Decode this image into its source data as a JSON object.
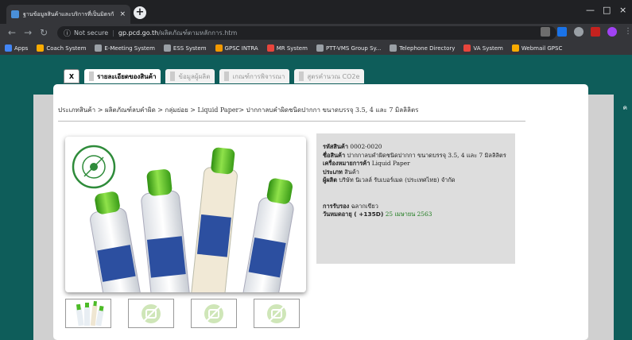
{
  "browser": {
    "tab_title": "ฐานข้อมูลสินค้าและบริการที่เป็นมิตรกั",
    "tab_close": "×",
    "new_tab": "+",
    "window_minimize": "—",
    "window_maximize": "□",
    "window_close": "×",
    "address": {
      "info": "ⓘ",
      "security_text": "Not secure",
      "domain": "gp.pcd.go.th",
      "path": "/ผลิตภัณฑ์ตามหลักการ.htm"
    },
    "bookmarks": [
      {
        "label": "Apps",
        "color": "#4285f4"
      },
      {
        "label": "Coach System",
        "color": "#f9ab00"
      },
      {
        "label": "E-Meeting System",
        "color": "#9aa0a6"
      },
      {
        "label": "ESS System",
        "color": "#9aa0a6"
      },
      {
        "label": "GPSC INTRA",
        "color": "#f29900"
      },
      {
        "label": "MR System",
        "color": "#e8453c"
      },
      {
        "label": "PTT-VMS Group Sy...",
        "color": "#9aa0a6"
      },
      {
        "label": "Telephone Directory",
        "color": "#9aa0a6"
      },
      {
        "label": "VA System",
        "color": "#e8453c"
      },
      {
        "label": "Webmail GPSC",
        "color": "#f9ab00"
      }
    ]
  },
  "page": {
    "right_label": "ค"
  },
  "modal": {
    "tabs": [
      {
        "label": "X"
      },
      {
        "label": "รายละเอียดของสินค้า"
      },
      {
        "label": "ข้อมูลผู้ผลิต"
      },
      {
        "label": "เกณฑ์การพิจารณา"
      },
      {
        "label": "สูตรคำนวณ CO2e"
      }
    ],
    "breadcrumb": "ประเภทสินค้า > ผลิตภัณฑ์ลบคำผิด > กลุ่มย่อย > Liquid Paper> ปากกาลบคำผิดชนิดปากกา ขนาดบรรจุ 3.5, 4 และ 7 มิลลิลิตร",
    "info": {
      "code_label": "รหัสสินค้า",
      "code_value": "0002-0020",
      "name_label": "ชื่อสินค้า",
      "name_value": "ปากกาลบคำผิดชนิดปากกา ขนาดบรรจุ 3.5, 4 และ 7 มิลลิลิตร",
      "brand_label": "เครื่องหมายการค้า",
      "brand_value": "Liquid Paper",
      "type_label": "ประเภท",
      "type_value": "สินค้า",
      "maker_label": "ผู้ผลิต",
      "maker_value": "บริษัท นิเวลล์ รับเบอร์เมด (ประเทศไทย) จำกัด",
      "cert_label": "การรับรอง",
      "cert_value": "ฉลากเขียว",
      "expiry_label": "วันหมดอายุ ( +135D)",
      "expiry_value": "25 เมษายน 2563"
    },
    "logo_text": "ฉลากเขียว"
  }
}
